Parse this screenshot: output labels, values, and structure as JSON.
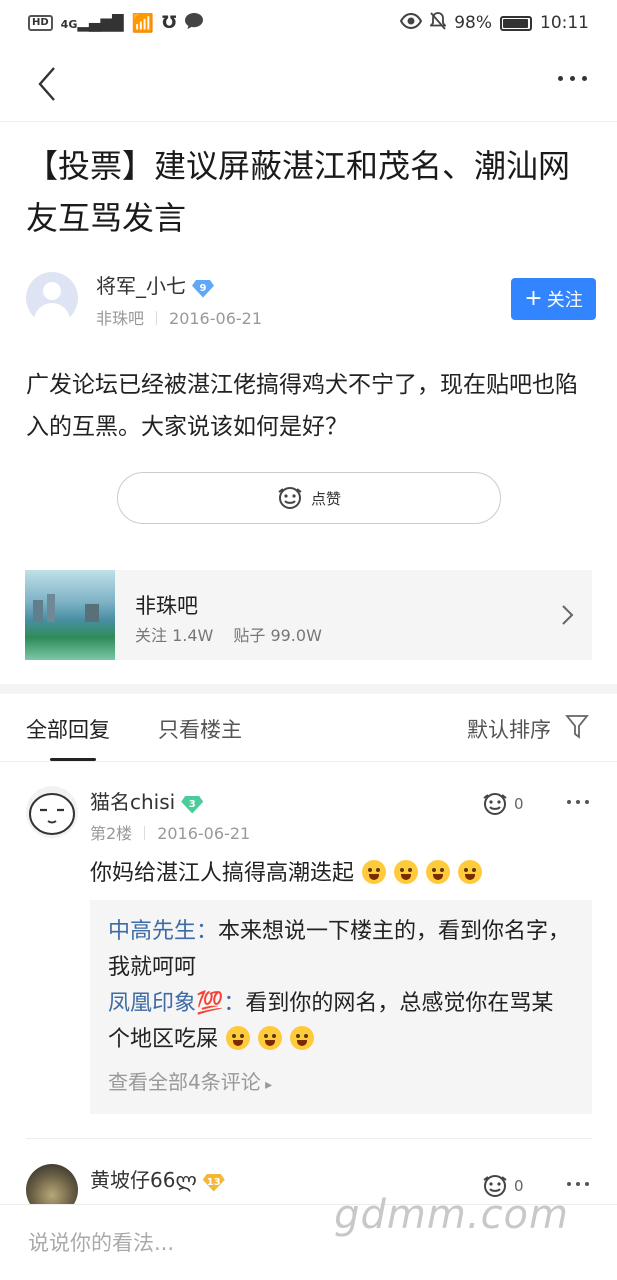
{
  "status_bar": {
    "network_badge": "HD",
    "signal_label": "4G",
    "battery_percent": "98%",
    "battery_level": 0.98,
    "time": "10:11"
  },
  "post": {
    "title": "【投票】建议屏蔽湛江和茂名、潮汕网友互骂发言",
    "author": {
      "name": "将军_小七",
      "level": "9",
      "level_color": "#5fa8f7",
      "forum": "非珠吧",
      "date": "2016-06-21"
    },
    "follow_label": "关注",
    "body": "广发论坛已经被湛江佬搞得鸡犬不宁了，现在贴吧也陷入的互黑。大家说该如何是好？",
    "like_label": "点赞"
  },
  "forum_card": {
    "name": "非珠吧",
    "followers_label": "关注 1.4W",
    "posts_label": "贴子 99.0W"
  },
  "tabs": {
    "all_replies": "全部回复",
    "op_only": "只看楼主",
    "sort": "默认排序"
  },
  "replies": [
    {
      "name": "猫名chisi",
      "level": "3",
      "level_color": "#4ccc9a",
      "floor": "第2楼",
      "date": "2016-06-21",
      "likes": "0",
      "text": "你妈给湛江人搞得高潮迭起",
      "subcomments": [
        {
          "user": "中高先生",
          "sep": "：",
          "text": "本来想说一下楼主的，看到你名字，我就呵呵"
        },
        {
          "user": "凤凰印象💯",
          "sep": "：",
          "text": "看到你的网名，总感觉你在骂某个地区吃屎"
        }
      ],
      "view_all": "查看全部4条评论"
    },
    {
      "name": "黄坡仔66ლ",
      "level": "13",
      "level_color": "#f5b731",
      "likes": "0"
    }
  ],
  "bottom": {
    "input_placeholder": "说说你的看法..."
  },
  "watermark": "gdmm.com"
}
